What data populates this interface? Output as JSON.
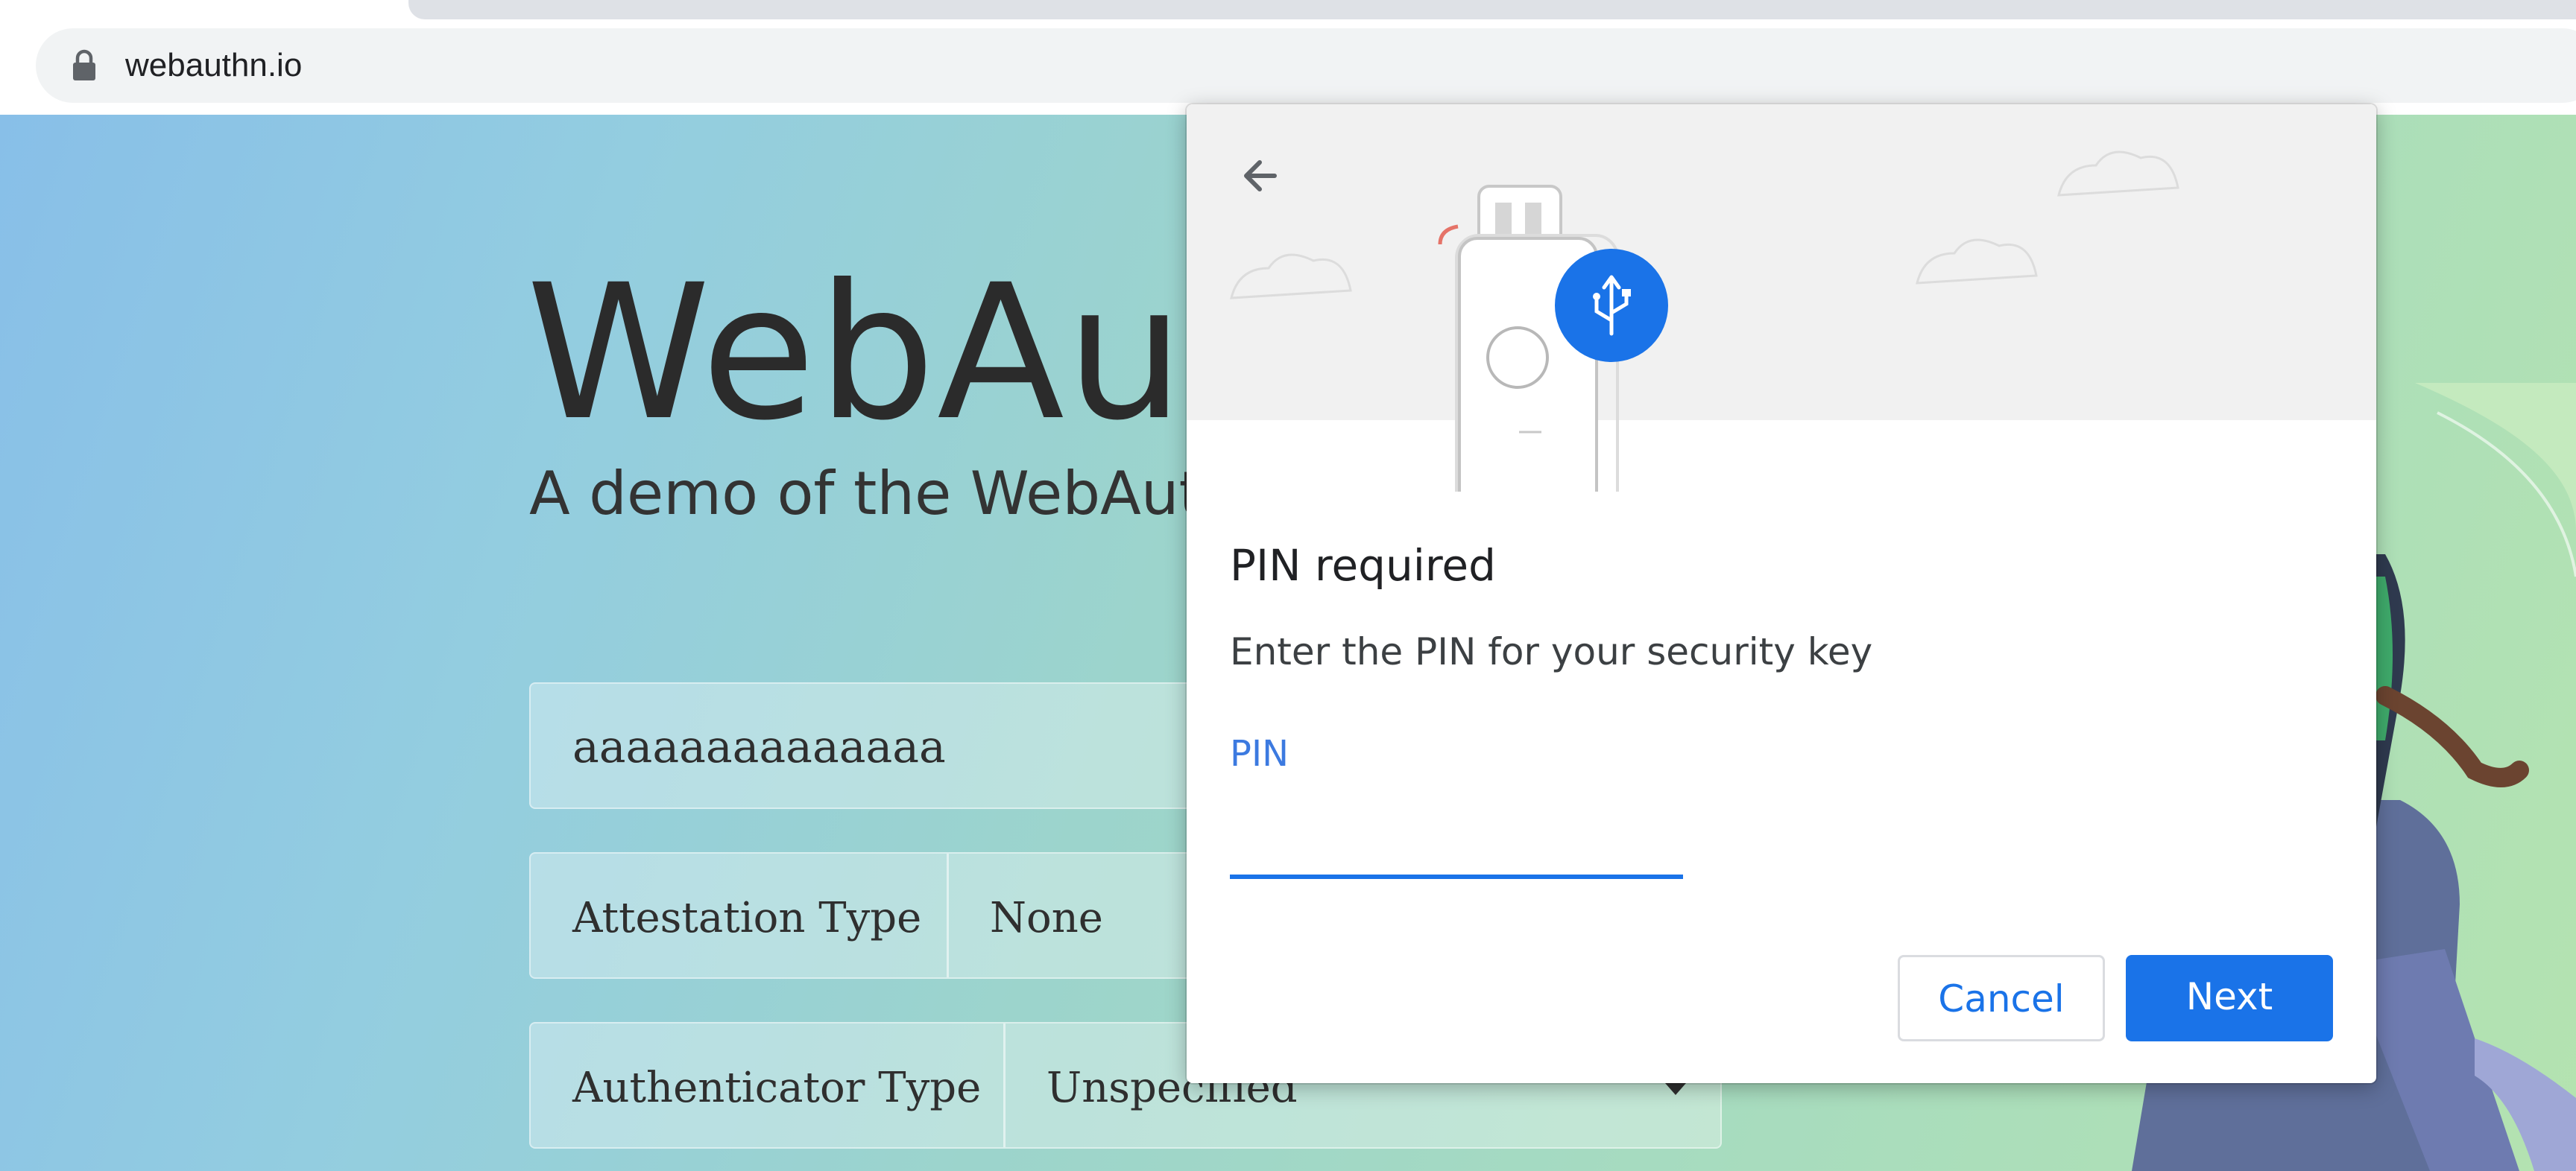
{
  "browser": {
    "url": "webauthn.io"
  },
  "page": {
    "title": "WebAuthn",
    "subtitle": "A demo of the WebAuthn specification",
    "username": {
      "value": "aaaaaaaaaaaaaa"
    },
    "attestation": {
      "label": "Attestation Type",
      "value": "None"
    },
    "authenticator": {
      "label": "Authenticator Type",
      "value": "Unspecified"
    }
  },
  "dialog": {
    "title": "PIN required",
    "description": "Enter the PIN for your security key",
    "pin_label": "PIN",
    "pin_value": "",
    "cancel_label": "Cancel",
    "next_label": "Next"
  },
  "icons": {
    "lock": "lock-icon",
    "back": "arrow-left-icon",
    "usb": "usb-icon",
    "security_key": "security-key-icon"
  },
  "colors": {
    "accent": "#1a73e8",
    "dialog_header_bg": "#f1f1f1",
    "page_gradient_start": "#88bfe8",
    "page_gradient_end": "#b4e3b0"
  }
}
